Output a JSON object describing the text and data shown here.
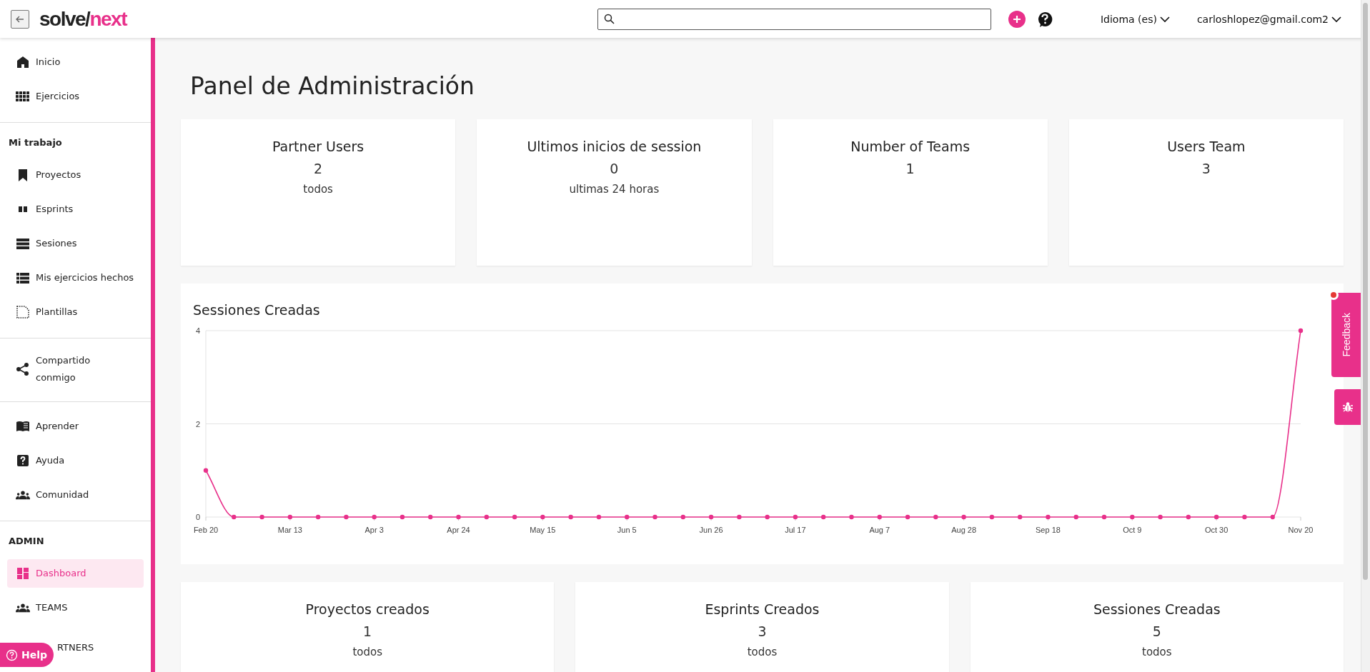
{
  "header": {
    "logo": {
      "part_1": "solve/",
      "part_2": "next"
    },
    "language": "Idioma (es)",
    "user": "carloshlopez@gmail.com2"
  },
  "sidebar": {
    "sections": [
      {
        "items": [
          {
            "label": "Inicio",
            "kind": "home",
            "selected": false
          },
          {
            "label": "Ejercicios",
            "kind": "grid",
            "selected": false
          }
        ]
      },
      {
        "heading": "Mi trabajo",
        "items": [
          {
            "label": "Proyectos",
            "kind": "bookmark",
            "selected": false
          },
          {
            "label": "Esprints",
            "kind": "columns",
            "selected": false
          },
          {
            "label": "Sesiones",
            "kind": "lines",
            "selected": false
          },
          {
            "label": "Mis ejercicios hechos",
            "kind": "list",
            "selected": false
          },
          {
            "label": "Plantillas",
            "kind": "dotted",
            "selected": false
          }
        ]
      },
      {
        "items": [
          {
            "label": "Compartido conmigo",
            "kind": "share",
            "selected": false
          }
        ]
      },
      {
        "items": [
          {
            "label": "Aprender",
            "kind": "book",
            "selected": false
          },
          {
            "label": "Ayuda",
            "kind": "question",
            "selected": false
          },
          {
            "label": "Comunidad",
            "kind": "people",
            "selected": false
          }
        ]
      },
      {
        "heading": "ADMIN",
        "items": [
          {
            "label": "Dashboard",
            "kind": "dashboard",
            "selected": true
          },
          {
            "label": "TEAMS",
            "kind": "people",
            "selected": false
          },
          {
            "label": "RTNERS",
            "kind": "covered",
            "selected": false
          }
        ]
      }
    ]
  },
  "help_button": {
    "label": "Help"
  },
  "page_title": "Panel de Administración",
  "top_cards": [
    {
      "title": "Partner Users",
      "value": "2",
      "caption": "todos"
    },
    {
      "title": "Ultimos inicios de session",
      "value": "0",
      "caption": "ultimas 24 horas"
    },
    {
      "title": "Number of Teams",
      "value": "1"
    },
    {
      "title": "Users Team",
      "value": "3"
    }
  ],
  "chart_card": {
    "title": "Sessiones Creadas",
    "chart_data": {
      "type": "line",
      "categories": [
        "Feb 20",
        null,
        null,
        "Mar 13",
        null,
        null,
        "Apr 3",
        null,
        null,
        "Apr 24",
        null,
        null,
        "May 15",
        null,
        null,
        "Jun 5",
        null,
        null,
        "Jun 26",
        null,
        null,
        "Jul 17",
        null,
        null,
        "Aug 7",
        null,
        null,
        "Aug 28",
        null,
        null,
        "Sep 18",
        null,
        null,
        "Oct 9",
        null,
        null,
        "Oct 30",
        null,
        null,
        "Nov 20"
      ],
      "ylim": [
        0,
        4
      ],
      "yticks": [
        0,
        2,
        4
      ],
      "series": [
        {
          "color": "#e8308a",
          "marker": true,
          "values": [
            1,
            0,
            0,
            0,
            0,
            0,
            0,
            0,
            0,
            0,
            0,
            0,
            0,
            0,
            0,
            0,
            0,
            0,
            0,
            0,
            0,
            0,
            0,
            0,
            0,
            0,
            0,
            0,
            0,
            0,
            0,
            0,
            0,
            0,
            0,
            0,
            0,
            0,
            0,
            4
          ]
        }
      ]
    }
  },
  "bottom_cards": [
    {
      "title": "Proyectos creados",
      "value": "1",
      "caption": "todos"
    },
    {
      "title": "Esprints Creados",
      "value": "3",
      "caption": "todos"
    },
    {
      "title": "Sessiones Creadas",
      "value": "5",
      "caption": "todos"
    }
  ],
  "feedback_tab": {
    "label": "Feedback"
  }
}
